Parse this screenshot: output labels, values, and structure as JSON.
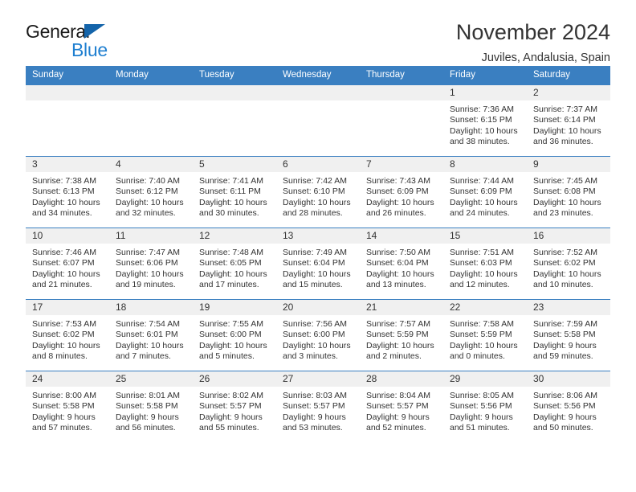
{
  "brand": {
    "word_one": "General",
    "word_two": "Blue",
    "triangle_color": "#1464aa",
    "blue_color": "#1f7fd0"
  },
  "header": {
    "title": "November 2024",
    "subtitle": "Juviles, Andalusia, Spain"
  },
  "colors": {
    "header_blue": "#3a7fc1",
    "day_band_gray": "#f0f0f0",
    "text": "#333333"
  },
  "weekdays": [
    "Sunday",
    "Monday",
    "Tuesday",
    "Wednesday",
    "Thursday",
    "Friday",
    "Saturday"
  ],
  "weeks": [
    [
      {
        "day": "",
        "sunrise": "",
        "sunset": "",
        "daylight_line1": "",
        "daylight_line2": ""
      },
      {
        "day": "",
        "sunrise": "",
        "sunset": "",
        "daylight_line1": "",
        "daylight_line2": ""
      },
      {
        "day": "",
        "sunrise": "",
        "sunset": "",
        "daylight_line1": "",
        "daylight_line2": ""
      },
      {
        "day": "",
        "sunrise": "",
        "sunset": "",
        "daylight_line1": "",
        "daylight_line2": ""
      },
      {
        "day": "",
        "sunrise": "",
        "sunset": "",
        "daylight_line1": "",
        "daylight_line2": ""
      },
      {
        "day": "1",
        "sunrise": "Sunrise: 7:36 AM",
        "sunset": "Sunset: 6:15 PM",
        "daylight_line1": "Daylight: 10 hours",
        "daylight_line2": "and 38 minutes."
      },
      {
        "day": "2",
        "sunrise": "Sunrise: 7:37 AM",
        "sunset": "Sunset: 6:14 PM",
        "daylight_line1": "Daylight: 10 hours",
        "daylight_line2": "and 36 minutes."
      }
    ],
    [
      {
        "day": "3",
        "sunrise": "Sunrise: 7:38 AM",
        "sunset": "Sunset: 6:13 PM",
        "daylight_line1": "Daylight: 10 hours",
        "daylight_line2": "and 34 minutes."
      },
      {
        "day": "4",
        "sunrise": "Sunrise: 7:40 AM",
        "sunset": "Sunset: 6:12 PM",
        "daylight_line1": "Daylight: 10 hours",
        "daylight_line2": "and 32 minutes."
      },
      {
        "day": "5",
        "sunrise": "Sunrise: 7:41 AM",
        "sunset": "Sunset: 6:11 PM",
        "daylight_line1": "Daylight: 10 hours",
        "daylight_line2": "and 30 minutes."
      },
      {
        "day": "6",
        "sunrise": "Sunrise: 7:42 AM",
        "sunset": "Sunset: 6:10 PM",
        "daylight_line1": "Daylight: 10 hours",
        "daylight_line2": "and 28 minutes."
      },
      {
        "day": "7",
        "sunrise": "Sunrise: 7:43 AM",
        "sunset": "Sunset: 6:09 PM",
        "daylight_line1": "Daylight: 10 hours",
        "daylight_line2": "and 26 minutes."
      },
      {
        "day": "8",
        "sunrise": "Sunrise: 7:44 AM",
        "sunset": "Sunset: 6:09 PM",
        "daylight_line1": "Daylight: 10 hours",
        "daylight_line2": "and 24 minutes."
      },
      {
        "day": "9",
        "sunrise": "Sunrise: 7:45 AM",
        "sunset": "Sunset: 6:08 PM",
        "daylight_line1": "Daylight: 10 hours",
        "daylight_line2": "and 23 minutes."
      }
    ],
    [
      {
        "day": "10",
        "sunrise": "Sunrise: 7:46 AM",
        "sunset": "Sunset: 6:07 PM",
        "daylight_line1": "Daylight: 10 hours",
        "daylight_line2": "and 21 minutes."
      },
      {
        "day": "11",
        "sunrise": "Sunrise: 7:47 AM",
        "sunset": "Sunset: 6:06 PM",
        "daylight_line1": "Daylight: 10 hours",
        "daylight_line2": "and 19 minutes."
      },
      {
        "day": "12",
        "sunrise": "Sunrise: 7:48 AM",
        "sunset": "Sunset: 6:05 PM",
        "daylight_line1": "Daylight: 10 hours",
        "daylight_line2": "and 17 minutes."
      },
      {
        "day": "13",
        "sunrise": "Sunrise: 7:49 AM",
        "sunset": "Sunset: 6:04 PM",
        "daylight_line1": "Daylight: 10 hours",
        "daylight_line2": "and 15 minutes."
      },
      {
        "day": "14",
        "sunrise": "Sunrise: 7:50 AM",
        "sunset": "Sunset: 6:04 PM",
        "daylight_line1": "Daylight: 10 hours",
        "daylight_line2": "and 13 minutes."
      },
      {
        "day": "15",
        "sunrise": "Sunrise: 7:51 AM",
        "sunset": "Sunset: 6:03 PM",
        "daylight_line1": "Daylight: 10 hours",
        "daylight_line2": "and 12 minutes."
      },
      {
        "day": "16",
        "sunrise": "Sunrise: 7:52 AM",
        "sunset": "Sunset: 6:02 PM",
        "daylight_line1": "Daylight: 10 hours",
        "daylight_line2": "and 10 minutes."
      }
    ],
    [
      {
        "day": "17",
        "sunrise": "Sunrise: 7:53 AM",
        "sunset": "Sunset: 6:02 PM",
        "daylight_line1": "Daylight: 10 hours",
        "daylight_line2": "and 8 minutes."
      },
      {
        "day": "18",
        "sunrise": "Sunrise: 7:54 AM",
        "sunset": "Sunset: 6:01 PM",
        "daylight_line1": "Daylight: 10 hours",
        "daylight_line2": "and 7 minutes."
      },
      {
        "day": "19",
        "sunrise": "Sunrise: 7:55 AM",
        "sunset": "Sunset: 6:00 PM",
        "daylight_line1": "Daylight: 10 hours",
        "daylight_line2": "and 5 minutes."
      },
      {
        "day": "20",
        "sunrise": "Sunrise: 7:56 AM",
        "sunset": "Sunset: 6:00 PM",
        "daylight_line1": "Daylight: 10 hours",
        "daylight_line2": "and 3 minutes."
      },
      {
        "day": "21",
        "sunrise": "Sunrise: 7:57 AM",
        "sunset": "Sunset: 5:59 PM",
        "daylight_line1": "Daylight: 10 hours",
        "daylight_line2": "and 2 minutes."
      },
      {
        "day": "22",
        "sunrise": "Sunrise: 7:58 AM",
        "sunset": "Sunset: 5:59 PM",
        "daylight_line1": "Daylight: 10 hours",
        "daylight_line2": "and 0 minutes."
      },
      {
        "day": "23",
        "sunrise": "Sunrise: 7:59 AM",
        "sunset": "Sunset: 5:58 PM",
        "daylight_line1": "Daylight: 9 hours",
        "daylight_line2": "and 59 minutes."
      }
    ],
    [
      {
        "day": "24",
        "sunrise": "Sunrise: 8:00 AM",
        "sunset": "Sunset: 5:58 PM",
        "daylight_line1": "Daylight: 9 hours",
        "daylight_line2": "and 57 minutes."
      },
      {
        "day": "25",
        "sunrise": "Sunrise: 8:01 AM",
        "sunset": "Sunset: 5:58 PM",
        "daylight_line1": "Daylight: 9 hours",
        "daylight_line2": "and 56 minutes."
      },
      {
        "day": "26",
        "sunrise": "Sunrise: 8:02 AM",
        "sunset": "Sunset: 5:57 PM",
        "daylight_line1": "Daylight: 9 hours",
        "daylight_line2": "and 55 minutes."
      },
      {
        "day": "27",
        "sunrise": "Sunrise: 8:03 AM",
        "sunset": "Sunset: 5:57 PM",
        "daylight_line1": "Daylight: 9 hours",
        "daylight_line2": "and 53 minutes."
      },
      {
        "day": "28",
        "sunrise": "Sunrise: 8:04 AM",
        "sunset": "Sunset: 5:57 PM",
        "daylight_line1": "Daylight: 9 hours",
        "daylight_line2": "and 52 minutes."
      },
      {
        "day": "29",
        "sunrise": "Sunrise: 8:05 AM",
        "sunset": "Sunset: 5:56 PM",
        "daylight_line1": "Daylight: 9 hours",
        "daylight_line2": "and 51 minutes."
      },
      {
        "day": "30",
        "sunrise": "Sunrise: 8:06 AM",
        "sunset": "Sunset: 5:56 PM",
        "daylight_line1": "Daylight: 9 hours",
        "daylight_line2": "and 50 minutes."
      }
    ]
  ]
}
